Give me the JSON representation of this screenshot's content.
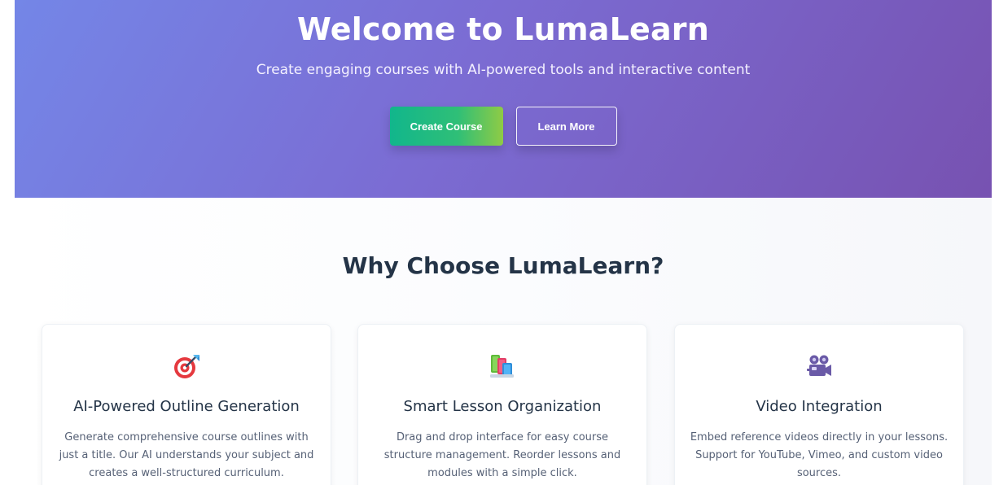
{
  "hero": {
    "title": "Welcome to LumaLearn",
    "subtitle": "Create engaging courses with AI-powered tools and interactive content",
    "primary_button": "Create Course",
    "secondary_button": "Learn More"
  },
  "features": {
    "title": "Why Choose LumaLearn?",
    "cards": [
      {
        "icon": "target-icon",
        "title": "AI-Powered Outline Generation",
        "description": "Generate comprehensive course outlines with just a title. Our AI understands your subject and creates a well-structured curriculum."
      },
      {
        "icon": "books-icon",
        "title": "Smart Lesson Organization",
        "description": "Drag and drop interface for easy course structure management. Reorder lessons and modules with a simple click."
      },
      {
        "icon": "video-camera-icon",
        "title": "Video Integration",
        "description": "Embed reference videos directly in your lessons. Support for YouTube, Vimeo, and custom video sources."
      }
    ]
  },
  "colors": {
    "hero_gradient_start": "#7486e7",
    "hero_gradient_end": "#7752b1",
    "primary_button_start": "#11b68c",
    "primary_button_end": "#8fcb45",
    "heading_text": "#243447",
    "body_text": "#566176"
  }
}
